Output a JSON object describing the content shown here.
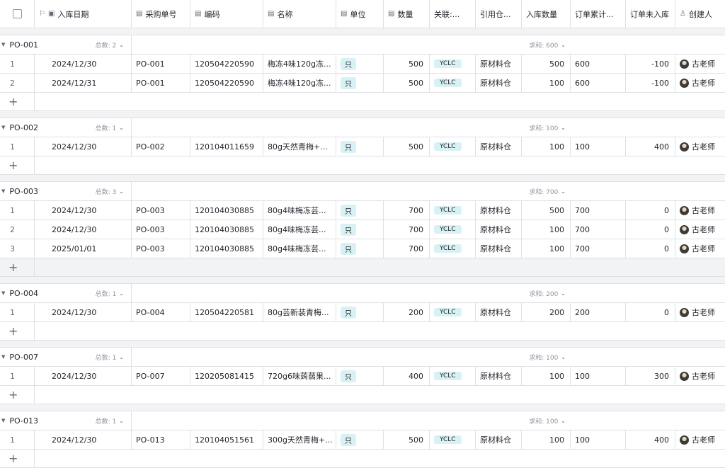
{
  "columns": {
    "date": "入库日期",
    "po": "采购单号",
    "code": "编码",
    "name": "名称",
    "unit": "单位",
    "qty": "数量",
    "link": "关联:...",
    "ref_wh": "引用仓...",
    "in_qty": "入库数量",
    "order_total": "订单累计...",
    "order_pending": "订单未入库",
    "creator": "创建人"
  },
  "groups": [
    {
      "name": "PO-001",
      "count_label": "总数: 2",
      "sum_label": "求和: 600",
      "rows": [
        {
          "idx": "1",
          "date": "2024/12/30",
          "po": "PO-001",
          "code": "120504220590",
          "name": "梅冻4味120g冻...",
          "unit": "只",
          "qty": "500",
          "link": "YCLC",
          "ref_wh": "原材料仓",
          "in_qty": "500",
          "order_total": "600",
          "order_pending": "-100",
          "creator": "古老师"
        },
        {
          "idx": "2",
          "date": "2024/12/31",
          "po": "PO-001",
          "code": "120504220590",
          "name": "梅冻4味120g冻...",
          "unit": "只",
          "qty": "500",
          "link": "YCLC",
          "ref_wh": "原材料仓",
          "in_qty": "100",
          "order_total": "600",
          "order_pending": "-100",
          "creator": "古老师"
        }
      ]
    },
    {
      "name": "PO-002",
      "count_label": "总数: 1",
      "sum_label": "求和: 100",
      "rows": [
        {
          "idx": "1",
          "date": "2024/12/30",
          "po": "PO-002",
          "code": "120104011659",
          "name": "80g天然青梅+...",
          "unit": "只",
          "qty": "500",
          "link": "YCLC",
          "ref_wh": "原材料仓",
          "in_qty": "100",
          "order_total": "100",
          "order_pending": "400",
          "creator": "古老师"
        }
      ]
    },
    {
      "name": "PO-003",
      "count_label": "总数: 3",
      "sum_label": "求和: 700",
      "rows": [
        {
          "idx": "1",
          "date": "2024/12/30",
          "po": "PO-003",
          "code": "120104030885",
          "name": "80g4味梅冻芸...",
          "unit": "只",
          "qty": "700",
          "link": "YCLC",
          "ref_wh": "原材料仓",
          "in_qty": "500",
          "order_total": "700",
          "order_pending": "0",
          "creator": "古老师"
        },
        {
          "idx": "2",
          "date": "2024/12/30",
          "po": "PO-003",
          "code": "120104030885",
          "name": "80g4味梅冻芸...",
          "unit": "只",
          "qty": "700",
          "link": "YCLC",
          "ref_wh": "原材料仓",
          "in_qty": "100",
          "order_total": "700",
          "order_pending": "0",
          "creator": "古老师"
        },
        {
          "idx": "3",
          "date": "2025/01/01",
          "po": "PO-003",
          "code": "120104030885",
          "name": "80g4味梅冻芸...",
          "unit": "只",
          "qty": "700",
          "link": "YCLC",
          "ref_wh": "原材料仓",
          "in_qty": "100",
          "order_total": "700",
          "order_pending": "0",
          "creator": "古老师"
        }
      ]
    },
    {
      "name": "PO-004",
      "count_label": "总数: 1",
      "sum_label": "求和: 200",
      "rows": [
        {
          "idx": "1",
          "date": "2024/12/30",
          "po": "PO-004",
          "code": "120504220581",
          "name": "80g芸新装青梅...",
          "unit": "只",
          "qty": "200",
          "link": "YCLC",
          "ref_wh": "原材料仓",
          "in_qty": "200",
          "order_total": "200",
          "order_pending": "0",
          "creator": "古老师"
        }
      ]
    },
    {
      "name": "PO-007",
      "count_label": "总数: 1",
      "sum_label": "求和: 100",
      "rows": [
        {
          "idx": "1",
          "date": "2024/12/30",
          "po": "PO-007",
          "code": "120205081415",
          "name": "720g6味蒟蒻果...",
          "unit": "只",
          "qty": "400",
          "link": "YCLC",
          "ref_wh": "原材料仓",
          "in_qty": "100",
          "order_total": "100",
          "order_pending": "300",
          "creator": "古老师"
        }
      ]
    },
    {
      "name": "PO-013",
      "count_label": "总数: 1",
      "sum_label": "求和: 100",
      "rows": [
        {
          "idx": "1",
          "date": "2024/12/30",
          "po": "PO-013",
          "code": "120104051561",
          "name": "300g天然青梅+...",
          "unit": "只",
          "qty": "500",
          "link": "YCLC",
          "ref_wh": "原材料仓",
          "in_qty": "100",
          "order_total": "100",
          "order_pending": "400",
          "creator": "古老师"
        }
      ]
    }
  ],
  "add_row_symbol": "+"
}
